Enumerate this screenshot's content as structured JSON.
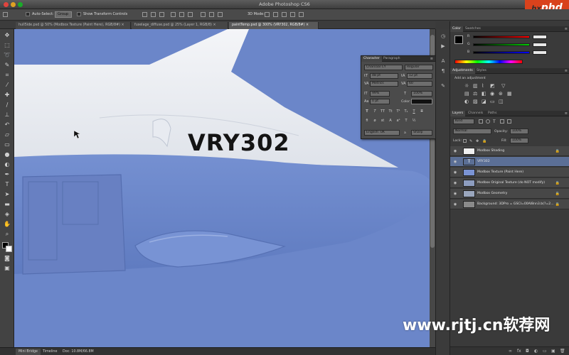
{
  "window": {
    "title": "Adobe Photoshop CS6"
  },
  "logo": {
    "prefix": "hx",
    "name": "phd"
  },
  "options": {
    "auto_select_label": "Auto-Select:",
    "auto_select_value": "Group",
    "transform_label": "Show Transform Controls",
    "mode_label": "3D Mode:"
  },
  "doc_tabs": [
    {
      "label": "hull5ide.psd @ 50% (Modbox Texture (Paint Here), RGB/8#) ×"
    },
    {
      "label": "fuselage_diffuse.psd @ 25% (Layer 1, RGB/8) ×"
    },
    {
      "label": "paintTemp.psd @ 300% (VRY302, RGB/8#) ×"
    }
  ],
  "canvas": {
    "text": "VRY302"
  },
  "status": {
    "tab_bridge": "Mini Bridge",
    "tab_timeline": "Timeline",
    "doc_info": "Doc: 10.8M/66.8M"
  },
  "character": {
    "tabs": [
      "Character",
      "Paragraph"
    ],
    "font_family": "Charcoal CY",
    "font_style": "Regular",
    "size": "48 pt",
    "leading": "12 pt",
    "kerning": "Metrics",
    "tracking": "60",
    "vscale": "99%",
    "hscale": "100%",
    "baseline": "0 pt",
    "color_label": "Color:",
    "language": "English: UK",
    "aa_label": "a",
    "antialias": "Sharp"
  },
  "color_panel": {
    "tabs": [
      "Color",
      "Swatches"
    ],
    "channels": [
      "R",
      "G",
      "B"
    ]
  },
  "adjustments": {
    "tabs": [
      "Adjustments",
      "Styles"
    ],
    "title": "Add an adjustment"
  },
  "layers_panel": {
    "tabs": [
      "Layers",
      "Channels",
      "Paths"
    ],
    "kind": "Kind",
    "blend_mode": "Normal",
    "opacity_label": "Opacity:",
    "opacity": "100%",
    "lock_label": "Lock:",
    "fill_label": "Fill:",
    "fill": "100%",
    "layers": [
      {
        "name": "Modbox Shading",
        "locked": true,
        "selected": false
      },
      {
        "name": "VRY302",
        "locked": false,
        "selected": true
      },
      {
        "name": "Modbox Texture (Paint Here)",
        "locked": false,
        "selected": false
      },
      {
        "name": "Modbox Original Texture (do NOT modify)",
        "locked": true,
        "selected": false
      },
      {
        "name": "Modbox Geometry",
        "locked": true,
        "selected": false
      },
      {
        "name": "Background: 3DPro = GSCI=00AI8nn3.b(?=2...",
        "locked": true,
        "selected": false
      }
    ]
  },
  "watermark": {
    "text": "www.rjtj.cn软荐网"
  },
  "colors": {
    "canvas_bg": "#6b86c9",
    "selection": "#5b6f96",
    "accent": "#d9421c"
  }
}
